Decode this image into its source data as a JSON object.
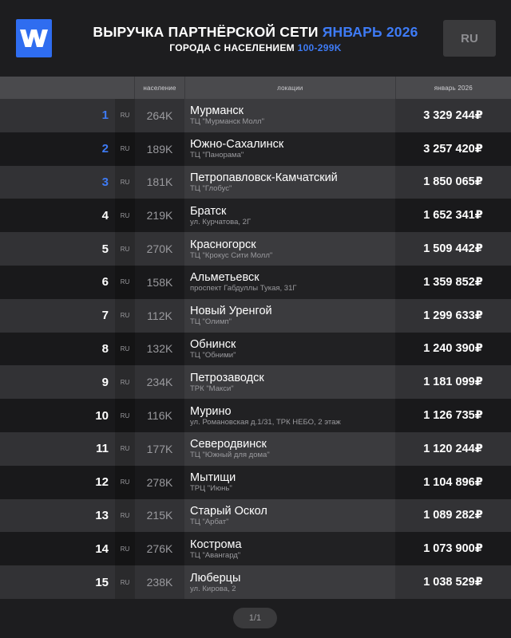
{
  "header": {
    "logo_letter": "W",
    "title_main": "ВЫРУЧКА ПАРТНЁРСКОЙ СЕТИ",
    "title_accent": "ЯНВАРЬ 2026",
    "subtitle_main": "ГОРОДА С НАСЕЛЕНИЕМ",
    "subtitle_accent": "100-299K",
    "lang": "RU",
    "accent_color": "#3e7bf5"
  },
  "columns": {
    "population": "население",
    "locations": "локации",
    "revenue": "январь 2026"
  },
  "rows": [
    {
      "rank": "1",
      "country": "RU",
      "population": "264K",
      "city": "Мурманск",
      "venue": "ТЦ \"Мурманск Молл\"",
      "revenue": "3 329 244₽"
    },
    {
      "rank": "2",
      "country": "RU",
      "population": "189K",
      "city": "Южно-Сахалинск",
      "venue": "ТЦ \"Панорама\"",
      "revenue": "3 257 420₽"
    },
    {
      "rank": "3",
      "country": "RU",
      "population": "181K",
      "city": "Петропавловск-Камчатский",
      "venue": "ТЦ \"Глобус\"",
      "revenue": "1 850 065₽"
    },
    {
      "rank": "4",
      "country": "RU",
      "population": "219K",
      "city": "Братск",
      "venue": "ул. Курчатова, 2Г",
      "revenue": "1 652 341₽"
    },
    {
      "rank": "5",
      "country": "RU",
      "population": "270K",
      "city": "Красногорск",
      "venue": "ТЦ \"Крокус Сити Молл\"",
      "revenue": "1 509 442₽"
    },
    {
      "rank": "6",
      "country": "RU",
      "population": "158K",
      "city": "Альметьевск",
      "venue": "проспект Габдуллы Тукая, 31Г",
      "revenue": "1 359 852₽"
    },
    {
      "rank": "7",
      "country": "RU",
      "population": "112K",
      "city": "Новый Уренгой",
      "venue": "ТЦ \"Олимп\"",
      "revenue": "1 299 633₽"
    },
    {
      "rank": "8",
      "country": "RU",
      "population": "132K",
      "city": "Обнинск",
      "venue": "ТЦ \"Обними\"",
      "revenue": "1 240 390₽"
    },
    {
      "rank": "9",
      "country": "RU",
      "population": "234K",
      "city": "Петрозаводск",
      "venue": "ТРК \"Макси\"",
      "revenue": "1 181 099₽"
    },
    {
      "rank": "10",
      "country": "RU",
      "population": "116K",
      "city": "Мурино",
      "venue": "ул. Романовская д.1/31, ТРК НЕБО, 2 этаж",
      "revenue": "1 126 735₽"
    },
    {
      "rank": "11",
      "country": "RU",
      "population": "177K",
      "city": "Северодвинск",
      "venue": "ТЦ \"Южный для дома\"",
      "revenue": "1 120 244₽"
    },
    {
      "rank": "12",
      "country": "RU",
      "population": "278K",
      "city": "Мытищи",
      "venue": "ТРЦ \"Июнь\"",
      "revenue": "1 104 896₽"
    },
    {
      "rank": "13",
      "country": "RU",
      "population": "215K",
      "city": "Старый Оскол",
      "venue": "ТЦ \"Арбат\"",
      "revenue": "1 089 282₽"
    },
    {
      "rank": "14",
      "country": "RU",
      "population": "276K",
      "city": "Кострома",
      "venue": "ТЦ \"Авангард\"",
      "revenue": "1 073 900₽"
    },
    {
      "rank": "15",
      "country": "RU",
      "population": "238K",
      "city": "Люберцы",
      "venue": "ул. Кирова, 2",
      "revenue": "1 038 529₽"
    }
  ],
  "pager": {
    "label": "1/1"
  }
}
